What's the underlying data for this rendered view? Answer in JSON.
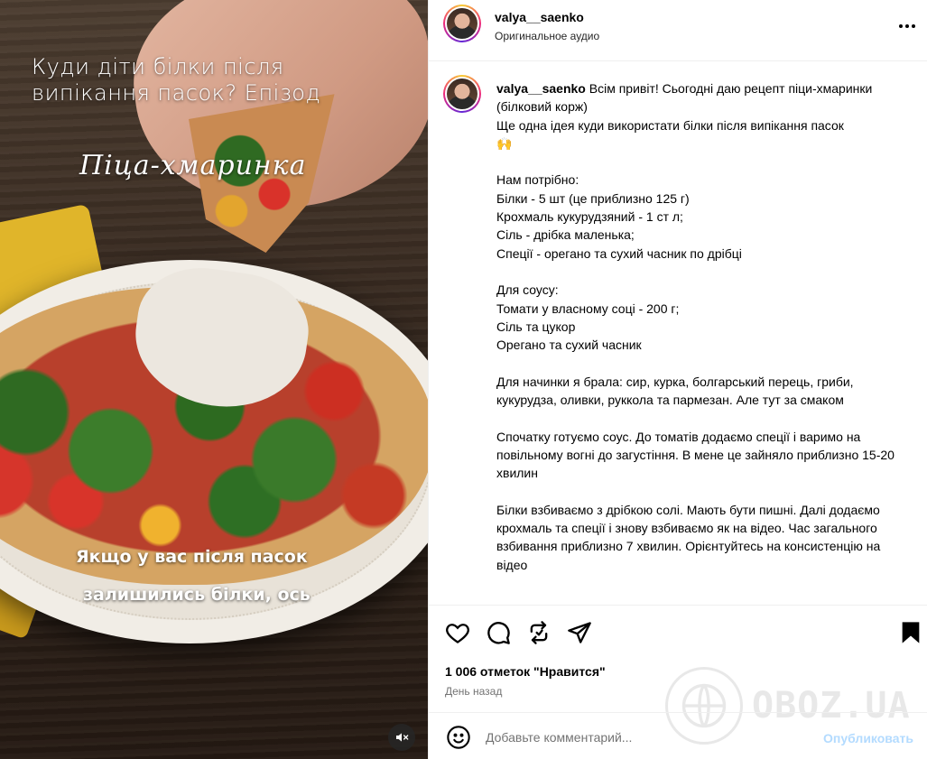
{
  "post": {
    "username": "valya__saenko",
    "audio_label": "Оригинальное аудио",
    "caption_intro": "Всім привіт! Сьогодні даю рецепт піци-хмаринки (білковий корж)",
    "caption_body": "\nЩе одна ідея куди використати білки після випікання пасок\n🙌\n\nНам потрібно:\nБілки - 5 шт (це приблизно 125 г)\nКрохмаль кукурудзяний - 1 ст л;\nСіль - дрібка маленька;\nСпеції - орегано та сухий часник по дрібці\n\nДля соусу:\nТомати у власному соці - 200 г;\nСіль та цукор\nОрегано та сухий часник\n\nДля начинки я брала: сир, курка, болгарський перець, гриби, кукурудза, оливки, руккола та пармезан. Але тут за смаком\n\nСпочатку готуємо соус. До томатів додаємо спеції і варимо на повільному вогні до загустіння. В мене це зайняло приблизно 15-20 хвилин\n\nБілки взбиваємо з дрібкою солі. Мають бути пишні. Далі додаємо крохмаль та спеції і знову взбиваємо як на відео. Час загального взбивання приблизно 7 хвилин. Орієнтуйтесь на консистенцію на відео",
    "likes": "1 006 отметок \"Нравится\"",
    "time_ago": "День назад"
  },
  "video": {
    "title": "Куди діти білки після випікання пасок? Епізод",
    "script_title": "Піца-хмаринка",
    "caption_line_1": "Якщо у вас після пасок",
    "caption_line_2": "залишились білки, ось"
  },
  "comment": {
    "placeholder": "Добавьте комментарий...",
    "post_label": "Опубликовать"
  },
  "watermark": {
    "text": "OBOZ.UA"
  },
  "icons": [
    "heart-icon",
    "comment-icon",
    "repost-icon",
    "share-icon",
    "bookmark-icon",
    "emoji-icon",
    "mute-icon",
    "more-icon"
  ],
  "colors": {
    "post_button": "#b3dbff",
    "secondary_text": "#737373",
    "divider": "#efefef"
  }
}
